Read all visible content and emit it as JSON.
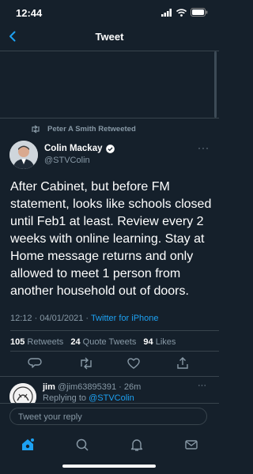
{
  "status": {
    "time": "12:44"
  },
  "nav": {
    "title": "Tweet"
  },
  "retweet": {
    "text": "Peter A Smith Retweeted"
  },
  "tweet": {
    "name": "Colin Mackay",
    "handle": "@STVColin",
    "text": "After Cabinet, but before FM statement, looks like schools closed until Feb1 at least. Review every 2 weeks with online learning. Stay at Home message returns and only allowed to meet 1 person from another household out of doors.",
    "timestamp": "12:12 · 04/01/2021 · ",
    "source": "Twitter for iPhone",
    "more": "···"
  },
  "stats": {
    "retweets_count": "105",
    "retweets_label": "Retweets",
    "quotes_count": "24",
    "quotes_label": "Quote Tweets",
    "likes_count": "94",
    "likes_label": "Likes"
  },
  "reply": {
    "name": "jim",
    "handle_time": "@jim63895391 · 26m",
    "replying_prefix": "Replying to ",
    "replying_handle": "@STVColin",
    "more": "···"
  },
  "composer": {
    "placeholder": "Tweet your reply"
  },
  "colors": {
    "background": "#15202b",
    "accent": "#1da1f2",
    "muted": "#8899a6"
  },
  "icons": [
    "back-icon",
    "retweet-icon",
    "verified-icon",
    "reply-icon",
    "like-icon",
    "share-icon",
    "home-icon",
    "search-icon",
    "notifications-icon",
    "messages-icon"
  ]
}
